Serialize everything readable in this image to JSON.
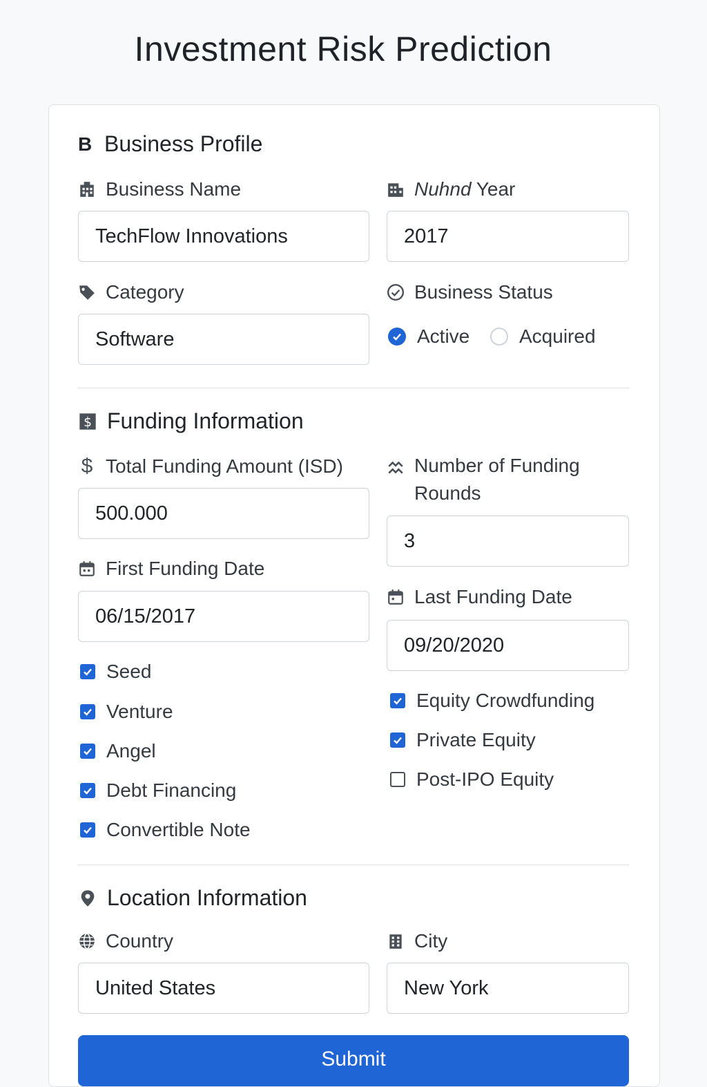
{
  "page_title": "Investment Risk Prediction",
  "business_profile": {
    "section_icon_text": "B",
    "title": "Business Profile",
    "business_name_label": "Business Name",
    "business_name_value": "TechFlow Innovations",
    "founded_year_label_italic": "Nuhnd",
    "founded_year_label_rest": "Year",
    "founded_year_value": "2017",
    "category_label": "Category",
    "category_value": "Software",
    "status_label": "Business Status",
    "status_options": [
      {
        "label": "Active",
        "selected": true
      },
      {
        "label": "Acquired",
        "selected": false
      }
    ]
  },
  "funding": {
    "title": "Funding Information",
    "total_amount_label": "Total Funding Amount (ISD)",
    "total_amount_value": "500.000",
    "rounds_label_line1": "Number of Funding",
    "rounds_label_line2": "Rounds",
    "rounds_value": "3",
    "first_date_label": "First Funding Date",
    "first_date_value": "06/15/2017",
    "last_date_label": "Last Funding Date",
    "last_date_value": "09/20/2020",
    "types_left": [
      {
        "label": "Seed",
        "checked": true
      },
      {
        "label": "Venture",
        "checked": true
      },
      {
        "label": "Angel",
        "checked": true
      },
      {
        "label": "Debt Financing",
        "checked": true
      },
      {
        "label": "Convertible Note",
        "checked": true
      }
    ],
    "types_right": [
      {
        "label": "Equity Crowdfunding",
        "checked": true
      },
      {
        "label": "Private Equity",
        "checked": true
      },
      {
        "label": "Post-IPO Equity",
        "checked": false
      }
    ]
  },
  "location": {
    "title": "Location Information",
    "country_label": "Country",
    "country_value": "United States",
    "city_label": "City",
    "city_value": "New York"
  },
  "submit_label": "Submit",
  "colors": {
    "accent": "#1f65d6",
    "background": "#f8f9fa",
    "border": "#ced4da"
  },
  "icons": [
    "building-icon",
    "calendar-building-icon",
    "tag-icon",
    "check-circle-icon",
    "dollar-box-icon",
    "dollar-icon",
    "rounds-icon",
    "calendar-icon",
    "map-pin-icon",
    "globe-icon",
    "city-icon"
  ]
}
